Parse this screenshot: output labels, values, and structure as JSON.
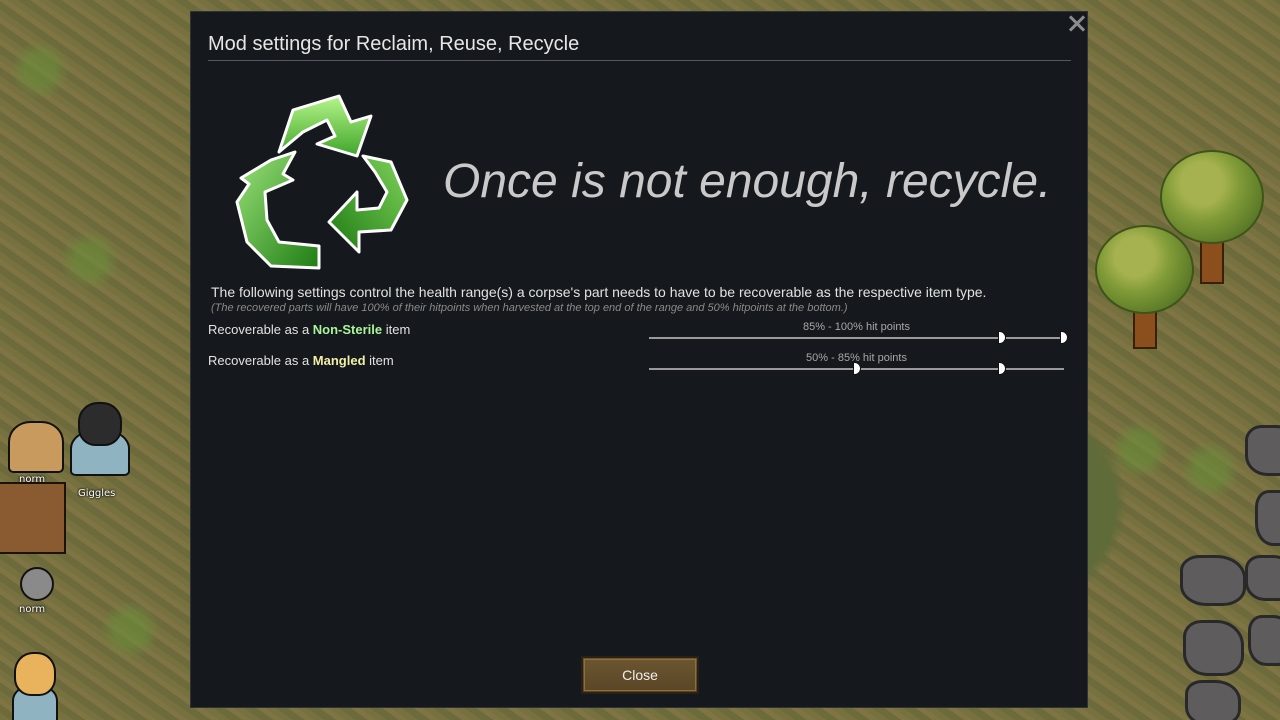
{
  "dialog": {
    "title": "Mod settings for Reclaim, Reuse, Recycle",
    "tagline": "Once is not enough, recycle.",
    "description": "The following settings control the health range(s) a corpse's part needs to have to be recoverable as the respective item type.",
    "note": "(The recovered parts will have 100% of their hitpoints when harvested at the top end of the range and 50% hitpoints at the bottom.)",
    "close_button_label": "Close",
    "logo_icon": "recycle-icon",
    "settings": [
      {
        "prefix": "Recoverable as a ",
        "keyword": "Non-Sterile",
        "keyword_color": "#a9f59a",
        "suffix": " item",
        "range_text": "85% - 100% hit points",
        "range_min_percent": 85,
        "range_max_percent": 100
      },
      {
        "prefix": "Recoverable as a ",
        "keyword": "Mangled",
        "keyword_color": "#f2f0a6",
        "suffix": " item",
        "range_text": "50% - 85% hit points",
        "range_min_percent": 50,
        "range_max_percent": 85
      }
    ]
  },
  "world": {
    "pawn_labels": [
      "norm",
      "Giggles",
      "norm"
    ]
  },
  "colors": {
    "dialog_bg": "#15181c",
    "button_bg": "#6b5630",
    "accent_green": "#a9f59a",
    "accent_yellow": "#f2f0a6"
  }
}
